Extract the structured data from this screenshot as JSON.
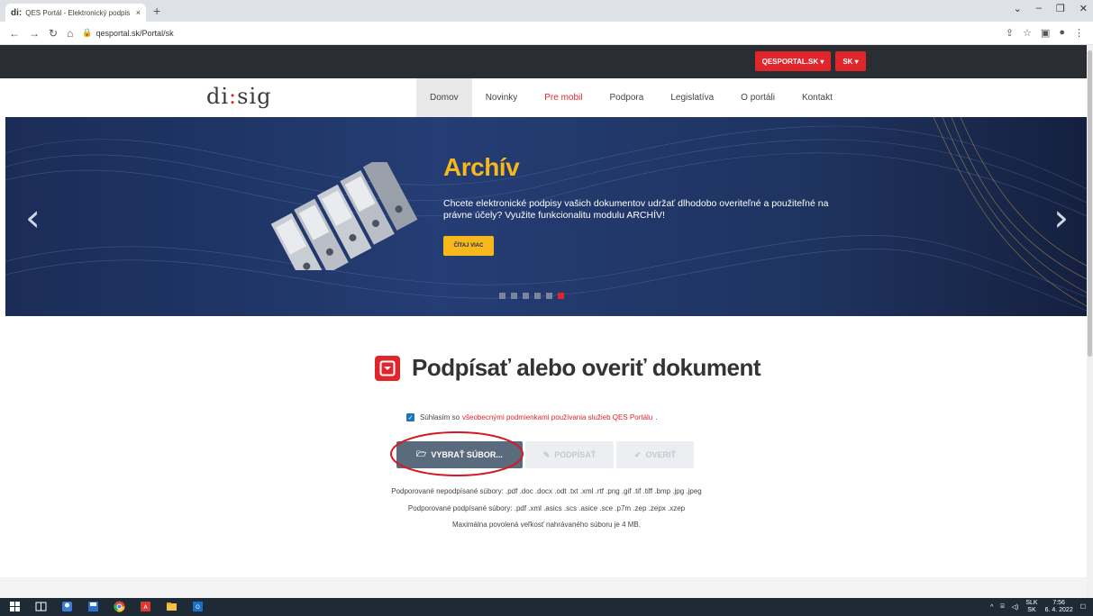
{
  "browser": {
    "tab_favicon": "di:",
    "tab_title": "QES Portál - Elektronický podpis",
    "tab_close": "×",
    "new_tab": "+",
    "url": "qesportal.sk/Portal/sk"
  },
  "topbar": {
    "portal_btn": "QESPORTAL.SK ▾",
    "lang_btn": "SK ▾"
  },
  "nav": {
    "logo_left": "di",
    "logo_dots": ":",
    "logo_right": "sig",
    "items": [
      "Domov",
      "Novinky",
      "Pre mobil",
      "Podpora",
      "Legislatíva",
      "O portáli",
      "Kontakt"
    ]
  },
  "hero": {
    "title": "Archív",
    "text": "Chcete elektronické podpisy vašich dokumentov udržať dlhodobo overiteľné a použiteľné na právne účely? Využite funkcionalitu modulu ARCHÍV!",
    "button": "ČÍTAJ VIAC",
    "prev": "‹",
    "next": "›",
    "slide_count": 6,
    "active_slide": 6
  },
  "main": {
    "title": "Podpísať alebo overiť dokument",
    "consent_prefix": "Súhlasím so",
    "consent_link": "všeobecnými podmienkami používania služieb QES Portálu",
    "consent_suffix": ".",
    "consent_checked": true,
    "btn_select": "VYBRAŤ SÚBOR...",
    "btn_sign": "PODPÍSAŤ",
    "btn_verify": "OVERIŤ",
    "info_unsigned": "Podporované nepodpísané súbory: .pdf .doc .docx .odt .txt .xml .rtf .png .gif .tif .tiff .bmp .jpg .jpeg",
    "info_signed": "Podporované podpísané súbory: .pdf .xml .asics .scs .asice .sce .p7m .zep .zepx .xzep",
    "info_max": "Maximálna povolená veľkosť nahrávaného súboru je 4 MB."
  },
  "taskbar": {
    "lang_top": "SLK",
    "lang_bottom": "SK",
    "time": "7:56",
    "date": "6. 4. 2022"
  },
  "colors": {
    "accent_red": "#e0262b",
    "hero_yellow": "#f6b81a",
    "hero_blue": "#1f335f"
  }
}
